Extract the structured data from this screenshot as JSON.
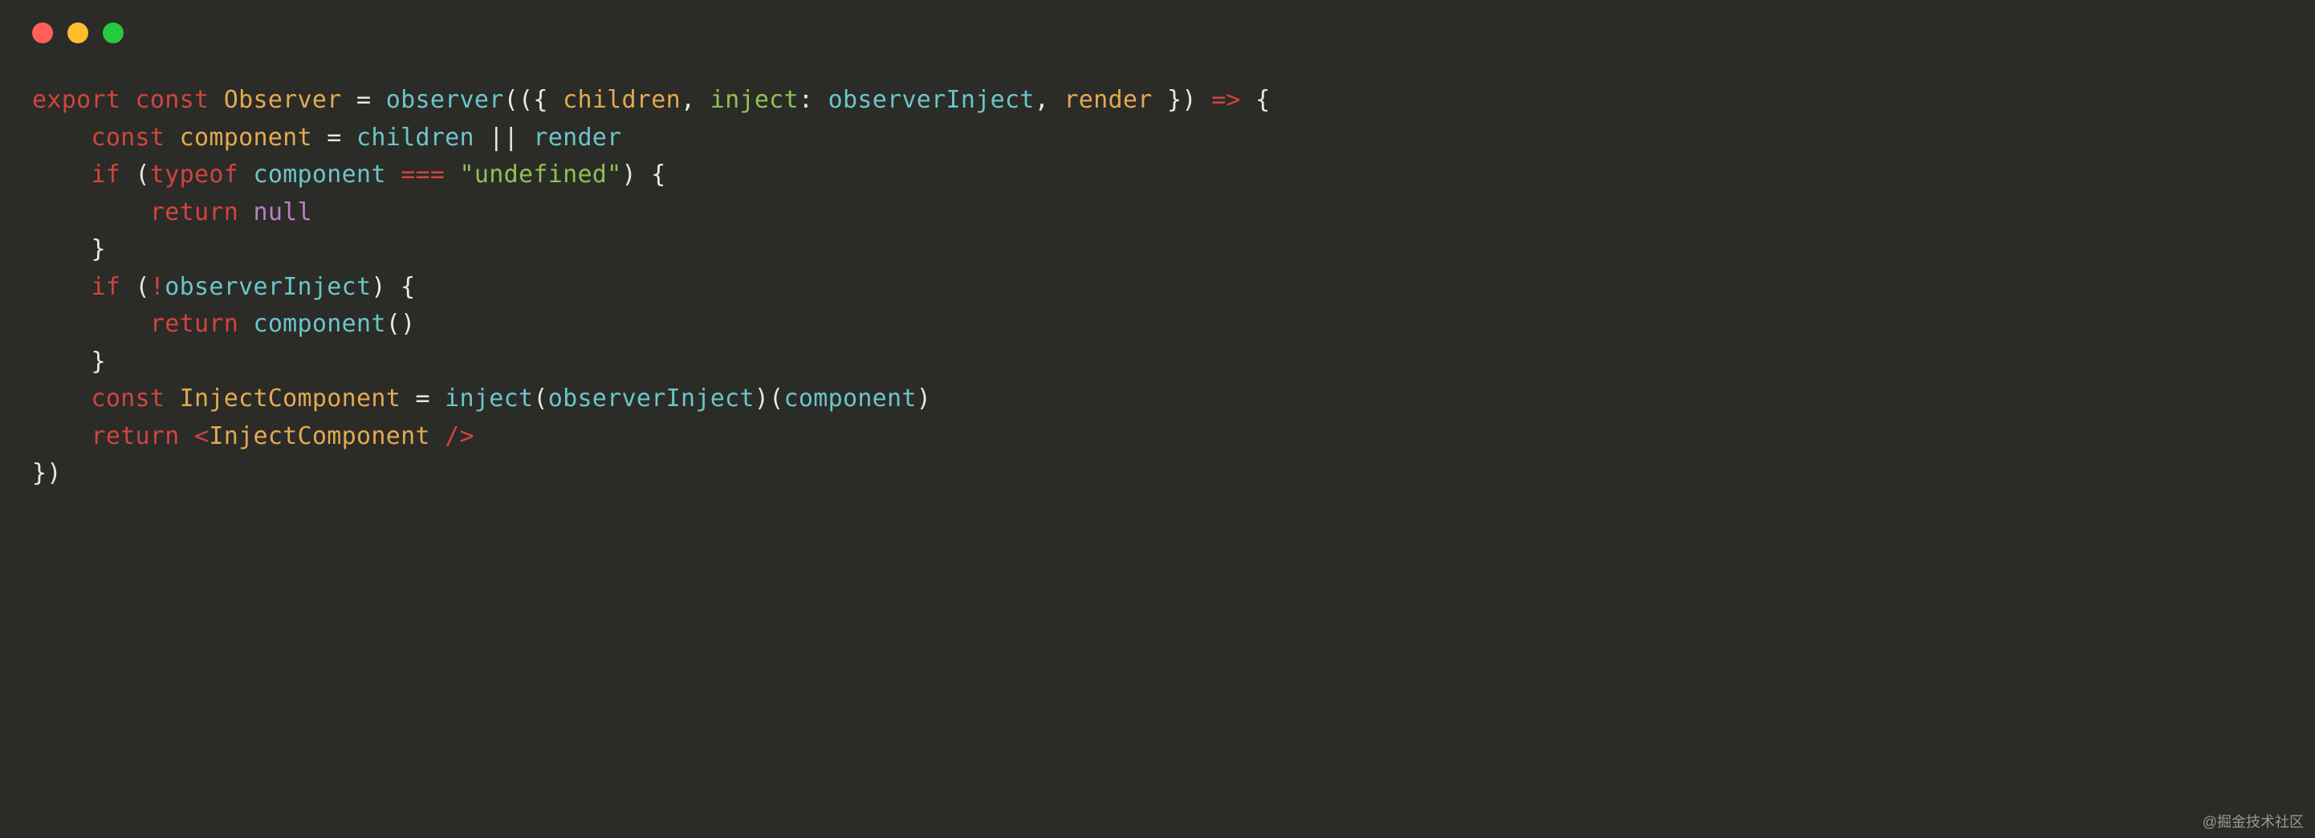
{
  "window": {
    "controls": [
      "close",
      "minimize",
      "maximize"
    ]
  },
  "code": {
    "line1": {
      "export": "export",
      "const": "const",
      "observer_id": "Observer",
      "eq": " = ",
      "observer_fn": "observer",
      "lparen": "(({ ",
      "children": "children",
      "comma1": ", ",
      "inject_key": "inject",
      "colon": ": ",
      "observer_inject": "observerInject",
      "comma2": ", ",
      "render": "render",
      "rparen": " }) ",
      "arrow": "=>",
      "brace": " {"
    },
    "line2": {
      "indent": "    ",
      "const": "const",
      "component": "component",
      "eq": " = ",
      "children": "children",
      "or": " || ",
      "render": "render"
    },
    "line3": {
      "indent": "    ",
      "if": "if",
      "lparen": " (",
      "typeof": "typeof",
      "sp": " ",
      "component": "component",
      "eq3": " === ",
      "str": "\"undefined\"",
      "rparen": ") {"
    },
    "line4": {
      "indent": "        ",
      "return": "return",
      "sp": " ",
      "null": "null"
    },
    "line5": {
      "indent": "    ",
      "brace": "}"
    },
    "line6": {
      "indent": "    ",
      "if": "if",
      "lparen": " (",
      "not": "!",
      "observer_inject": "observerInject",
      "rparen": ") {"
    },
    "line7": {
      "indent": "        ",
      "return": "return",
      "sp": " ",
      "component": "component",
      "call": "()"
    },
    "line8": {
      "indent": "    ",
      "brace": "}"
    },
    "line9": {
      "indent": "    ",
      "const": "const",
      "inject_comp": "InjectComponent",
      "eq": " = ",
      "inject_fn": "inject",
      "lparen1": "(",
      "observer_inject": "observerInject",
      "rparen1": ")(",
      "component": "component",
      "rparen2": ")"
    },
    "line10": {
      "indent": "    ",
      "return": "return",
      "sp": " ",
      "lt": "<",
      "jsx_name": "InjectComponent",
      "close": " />"
    },
    "line11": {
      "brace": "})"
    }
  },
  "watermark": "@掘金技术社区"
}
